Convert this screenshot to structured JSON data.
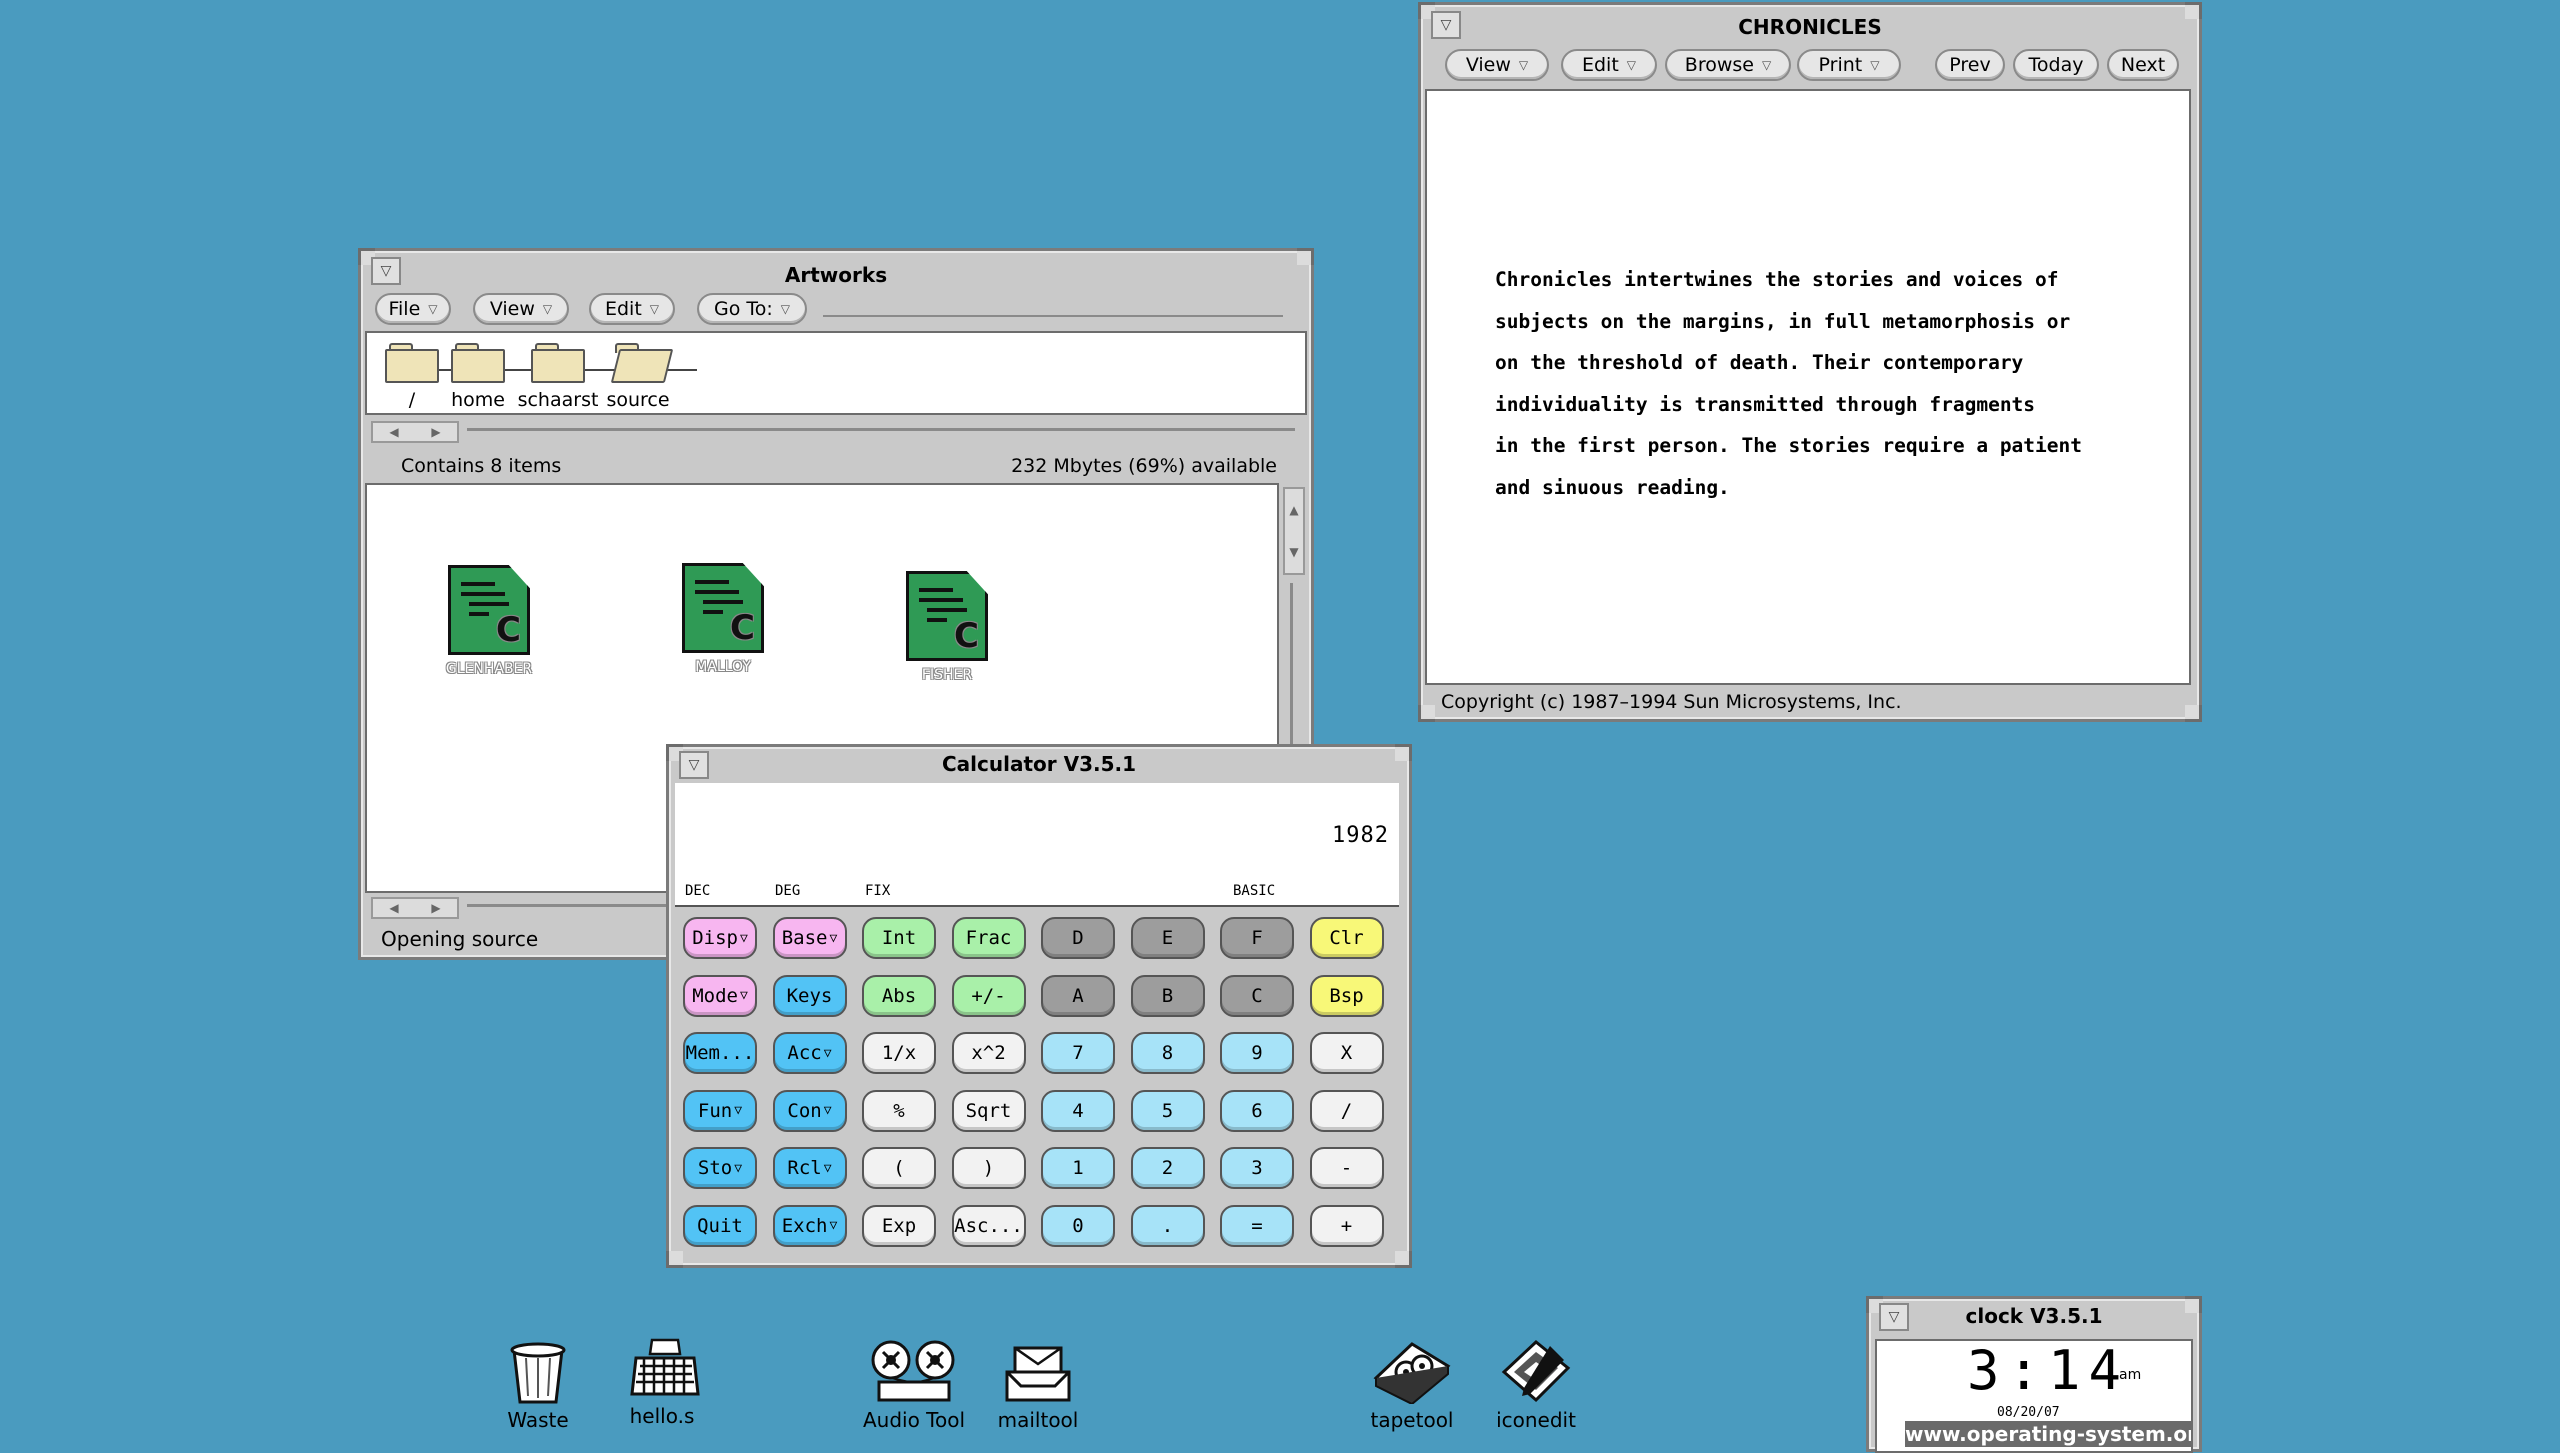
{
  "file_manager": {
    "title": "Artworks",
    "menus": [
      {
        "label": "File"
      },
      {
        "label": "View"
      },
      {
        "label": "Edit"
      },
      {
        "label": "Go To:"
      }
    ],
    "path": [
      "/",
      "home",
      "schaarst",
      "source"
    ],
    "contains": "Contains 8 items",
    "available": "232 Mbytes (69%) available",
    "files": [
      "GLENHABER",
      "MALLOY",
      "FISHER"
    ],
    "status": "Opening source"
  },
  "chronicles": {
    "title": "CHRONICLES",
    "menus": [
      {
        "label": "View"
      },
      {
        "label": "Edit"
      },
      {
        "label": "Browse"
      },
      {
        "label": "Print"
      }
    ],
    "nav": [
      "Prev",
      "Today",
      "Next"
    ],
    "lines": [
      "Chronicles intertwines the stories and voices of",
      "subjects on the margins, in full metamorphosis or",
      "on the threshold of death. Their contemporary",
      "individuality is transmitted through fragments",
      "in the first person. The stories require a patient",
      "and sinuous reading."
    ],
    "copyright": "Copyright (c) 1987–1994 Sun Microsystems, Inc."
  },
  "calculator": {
    "title": "Calculator V3.5.1",
    "display": "1982",
    "modes": {
      "base": "DEC",
      "angle": "DEG",
      "format": "FIX",
      "mode": "BASIC"
    },
    "rows": [
      [
        "Disp",
        "Base",
        "Int",
        "Frac",
        "D",
        "E",
        "F",
        "Clr"
      ],
      [
        "Mode",
        "Keys",
        "Abs",
        "+/-",
        "A",
        "B",
        "C",
        "Bsp"
      ],
      [
        "Mem...",
        "Acc",
        "1/x",
        "x^2",
        "7",
        "8",
        "9",
        "X"
      ],
      [
        "Fun",
        "Con",
        "%",
        "Sqrt",
        "4",
        "5",
        "6",
        "/"
      ],
      [
        "Sto",
        "Rcl",
        "(",
        ")",
        "1",
        "2",
        "3",
        "-"
      ],
      [
        "Quit",
        "Exch",
        "Exp",
        "Asc...",
        "0",
        ".",
        "=",
        "+"
      ]
    ],
    "colors": {
      "pink": "#f7b6f0",
      "blue": "#52c3f5",
      "green": "#a9f0a9",
      "gray": "#9d9d9d",
      "yellow": "#f8f878",
      "lightblue": "#a7e3f8",
      "white": "#f2f2f2"
    }
  },
  "clock": {
    "title": "clock V3.5.1",
    "time": "3:14",
    "ampm": "am",
    "date": "08/20/07",
    "watermark": "www.operating-system.org"
  },
  "desktop_icons": [
    {
      "label": "Waste",
      "icon": "trash-can-icon"
    },
    {
      "label": "hello.s",
      "icon": "keyboard-icon"
    },
    {
      "label": "Audio Tool",
      "icon": "tape-reels-icon"
    },
    {
      "label": "mailtool",
      "icon": "mail-tray-icon"
    },
    {
      "label": "tapetool",
      "icon": "tape-drive-icon"
    },
    {
      "label": "iconedit",
      "icon": "icon-editor-icon"
    }
  ],
  "theme": {
    "desktop": "#4a9bbf",
    "window": "#c9c9c9"
  }
}
